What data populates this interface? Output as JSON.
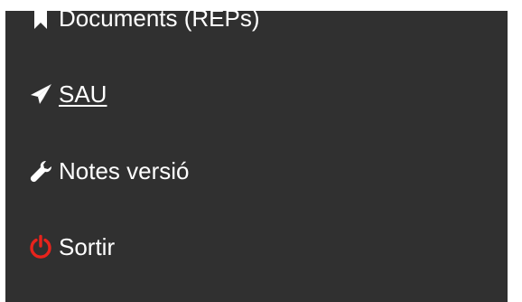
{
  "menu": {
    "items": [
      {
        "label": "Documents (REPs)",
        "icon": "bookmark-icon"
      },
      {
        "label": "SAU",
        "icon": "paper-plane-icon"
      },
      {
        "label": "Notes versió",
        "icon": "wrench-icon"
      },
      {
        "label": "Sortir",
        "icon": "power-icon"
      }
    ]
  },
  "colors": {
    "panel_background": "#303030",
    "text": "#ffffff",
    "logout_icon": "#e8231c"
  }
}
